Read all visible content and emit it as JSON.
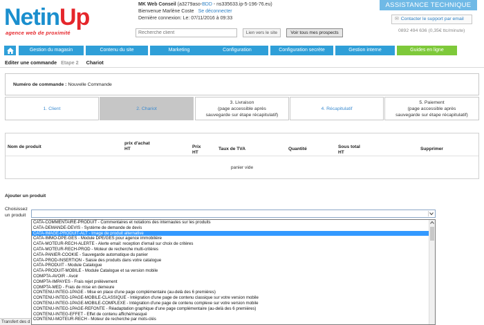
{
  "logo": {
    "main_a": "Netin",
    "main_b": "Up",
    "sub": "agence web de proximité"
  },
  "account": {
    "company": "MK Web Conseil",
    "id_pre": "(a3279aso-",
    "bdd": "BDD",
    "id_post": "- ns335633.ip-5-196-76.eu)",
    "welcome": "Bienvenue Marlène Coste",
    "logout": "Se déconnecter",
    "last_login": "Dernière connexion: Le: 07/11/2016 à 09:33"
  },
  "search": {
    "placeholder": "Recherche client",
    "site_link": "Lien vers le site",
    "prospects": "Voir tous mes prospects"
  },
  "assist": {
    "title": "ASSISTANCE TECHNIQUE",
    "contact": "Contacter le support par email",
    "phone": "0892 494 636 (0,35€ ttc/minute)"
  },
  "nav": [
    "Gestion du magasin",
    "Contenu du site",
    "Marketing",
    "Configuration",
    "Configuration secrète",
    "Gestion interne",
    "Guides en ligne"
  ],
  "breadcrumb": {
    "title": "Editer une commande",
    "step": "Etape 2",
    "current": "Chariot"
  },
  "order": {
    "label": "Numéro de commande :",
    "value": "Nouvelle Commande"
  },
  "steps": [
    {
      "l1": "1. Client",
      "l2": "",
      "l3": ""
    },
    {
      "l1": "2. Chariot",
      "l2": "",
      "l3": ""
    },
    {
      "l1": "3. Livraison",
      "l2": "(page accessible après",
      "l3": "sauvegarde sur étape récapitulatif)"
    },
    {
      "l1": "4. Récapitulatif",
      "l2": "",
      "l3": ""
    },
    {
      "l1": "5. Paiement",
      "l2": "(page accessible après",
      "l3": "sauvegarde sur étape récapitulatif)"
    }
  ],
  "table": {
    "h_name": "Nom de produit",
    "h_buy1": "prix d'achat",
    "h_buy2": "HT",
    "h_price1": "Prix",
    "h_price2": "HT",
    "h_tax": "Taux de TVA",
    "h_qty": "Quantité",
    "h_sub1": "Sous total",
    "h_sub2": "HT",
    "h_del": "Supprimer",
    "empty": "panier vide"
  },
  "add": {
    "title": "Ajouter un produit",
    "choose1": "Choisissez",
    "choose2": "un produit"
  },
  "options": [
    "CATA-COMMENTAIRE-PRODUIT - Commentaires et notations des internautes sur les produits",
    "CATA-DEMANDE-DEVIS - Système de demande de devis",
    "CATA-IMAGE-PRODUIT-ALT - Image de produit alternative",
    "CATA-IMMO-DPE-GES - Module DPE/GES pour agence immobilière",
    "CATA-MOTEUR-RECH-ALERTE - Alerte email: reception d'email sur choix de critères",
    "CATA-MOTEUR-RECH-PROD - Moteur de recherche multi-critères",
    "CATA-PANIER-COOKIE - Sauvegarde automatique du panier",
    "CATA-PROD-INSERTION - Saisie des produits dans votre catalogue",
    "CATA-PRODUIT - Module Catalogue",
    "CATA-PRODUIT-MOBILE - Module Catalogue et sa version mobile",
    "COMPTA-AVOIR - Avoir",
    "COMPTA-IMPAYES - Frais rejet prélèvement",
    "COMPTA-MED - Frais de mise en demeure",
    "CONTENU-INTEG-1PAGE - Mise en place d'une page complémentaire (au-delà des 6 premières)",
    "CONTENU-INTEG-1PAGE-MOBILE-CLASSIQUE - Intégration d'une page de contenu classique sur votre version mobile",
    "CONTENU-INTEG-1PAGE-MOBILE-COMPLEXE - Intégration d'une page de contenu complexe sur votre version mobile",
    "CONTENU-INTEG-1PAGE-REFONTE - Réadaptation graphique d'une page complémentaire (au-delà des 6 premières)",
    "CONTENU-INTEG-EFFET - Effet de contenu affiché/masqué",
    "CONTENU-MOTEUR-RECH - Moteur de recherche par mots-clés"
  ],
  "selected_index": 2,
  "status": "Transfert des d"
}
